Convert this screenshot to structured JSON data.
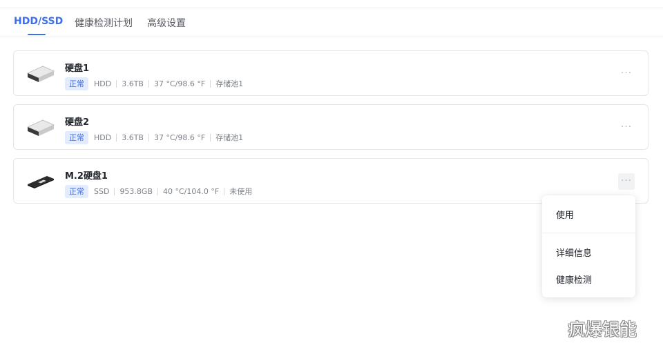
{
  "tabs": [
    {
      "label": "HDD/SSD",
      "active": true
    },
    {
      "label": "健康检测计划",
      "active": false
    },
    {
      "label": "高级设置",
      "active": false
    }
  ],
  "disks": [
    {
      "name": "硬盘1",
      "status": "正常",
      "type": "HDD",
      "capacity": "3.6TB",
      "temperature": "37 °C/98.6 °F",
      "pool": "存储池1",
      "icon": "hdd-drive-icon"
    },
    {
      "name": "硬盘2",
      "status": "正常",
      "type": "HDD",
      "capacity": "3.6TB",
      "temperature": "37 °C/98.6 °F",
      "pool": "存储池1",
      "icon": "hdd-drive-icon"
    },
    {
      "name": "M.2硬盘1",
      "status": "正常",
      "type": "SSD",
      "capacity": "953.8GB",
      "temperature": "40 °C/104.0 °F",
      "pool": "未使用",
      "icon": "m2-ssd-icon"
    }
  ],
  "more_label": "···",
  "menu": {
    "items": [
      "使用",
      "详细信息",
      "健康检测"
    ]
  },
  "watermark": "疯爆银能",
  "colors": {
    "accent": "#3a6ff0",
    "badge_bg": "#e3ebff",
    "border": "#e6e6e6"
  }
}
